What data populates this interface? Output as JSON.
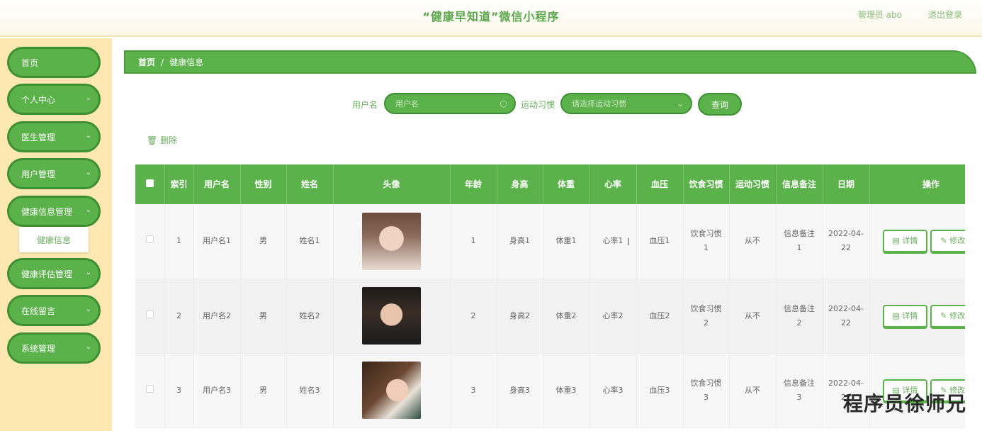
{
  "header": {
    "title": "“健康早知道”微信小程序",
    "user": "管理员  abo",
    "logout": "退出登录"
  },
  "sidebar": {
    "items": [
      {
        "label": "首页",
        "has_children": false
      },
      {
        "label": "个人中心",
        "has_children": true
      },
      {
        "label": "医生管理",
        "has_children": true
      },
      {
        "label": "用户管理",
        "has_children": true
      },
      {
        "label": "健康信息管理",
        "has_children": true
      },
      {
        "label": "健康评估管理",
        "has_children": true
      },
      {
        "label": "在线留言",
        "has_children": true
      },
      {
        "label": "系统管理",
        "has_children": true
      }
    ],
    "active_sub": "健康信息"
  },
  "breadcrumb": {
    "home": "首页",
    "separator": "/",
    "current": "健康信息"
  },
  "search": {
    "username_label": "用户名",
    "username_placeholder": "用户名",
    "exercise_label": "运动习惯",
    "exercise_placeholder": "请选择运动习惯",
    "query_button": "查询"
  },
  "actions": {
    "delete": "删除"
  },
  "table": {
    "columns": [
      "索引",
      "用户名",
      "性别",
      "姓名",
      "头像",
      "年龄",
      "身高",
      "体重",
      "心率",
      "血压",
      "饮食习惯",
      "运动习惯",
      "信息备注",
      "日期",
      "操作"
    ],
    "rows": [
      {
        "index": "1",
        "username": "用户名1",
        "gender": "男",
        "name": "姓名1",
        "age": "1",
        "height": "身高1",
        "weight": "体重1",
        "heart_rate": "心率1",
        "blood_pressure": "血压1",
        "diet_a": "饮食习惯",
        "diet_b": "1",
        "exercise": "从不",
        "note_a": "信息备注",
        "note_b": "1",
        "date_a": "2022-04-",
        "date_b": "22",
        "detail": "详情",
        "edit": "修改"
      },
      {
        "index": "2",
        "username": "用户名2",
        "gender": "男",
        "name": "姓名2",
        "age": "2",
        "height": "身高2",
        "weight": "体重2",
        "heart_rate": "心率2",
        "blood_pressure": "血压2",
        "diet_a": "饮食习惯",
        "diet_b": "2",
        "exercise": "从不",
        "note_a": "信息备注",
        "note_b": "2",
        "date_a": "2022-04-",
        "date_b": "22",
        "detail": "详情",
        "edit": "修改"
      },
      {
        "index": "3",
        "username": "用户名3",
        "gender": "男",
        "name": "姓名3",
        "age": "3",
        "height": "身高3",
        "weight": "体重3",
        "heart_rate": "心率3",
        "blood_pressure": "血压3",
        "diet_a": "饮食习惯",
        "diet_b": "3",
        "exercise": "从不",
        "note_a": "信息备注",
        "note_b": "3",
        "date_a": "2022-04-",
        "date_b": "22",
        "detail": "详情",
        "edit": "修改"
      }
    ]
  },
  "icons": {
    "search": "search-icon",
    "chevron": "chevron-down-icon",
    "trash": "trash-icon",
    "detail": "document-icon",
    "edit": "pencil-icon"
  },
  "colors": {
    "primary": "#5bb24a",
    "primary_dark": "#3d8f31",
    "sidebar_bg": "#fde8b2",
    "text_green": "#6cae60"
  },
  "watermark": "程序员徐师兄"
}
